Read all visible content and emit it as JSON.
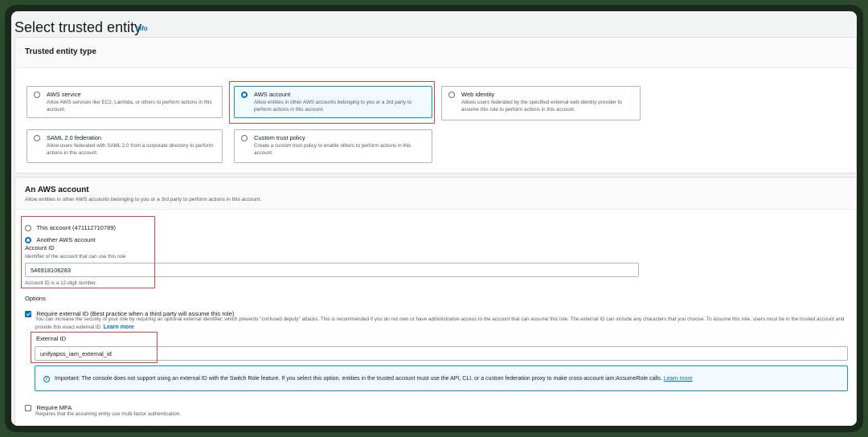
{
  "header": {
    "title": "Select trusted entity",
    "info": "Info"
  },
  "trusted_entity": {
    "title": "Trusted entity type",
    "options": [
      {
        "label": "AWS service",
        "desc": "Allow AWS services like EC2, Lambda, or others to perform actions in this account.",
        "selected": false
      },
      {
        "label": "AWS account",
        "desc": "Allow entities in other AWS accounts belonging to you or a 3rd party to perform actions in this account.",
        "selected": true
      },
      {
        "label": "Web identity",
        "desc": "Allows users federated by the specified external web identity provider to assume this role to perform actions in this account.",
        "selected": false
      },
      {
        "label": "SAML 2.0 federation",
        "desc": "Allow users federated with SAML 2.0 from a corporate directory to perform actions in this account.",
        "selected": false
      },
      {
        "label": "Custom trust policy",
        "desc": "Create a custom trust policy to enable others to perform actions in this account.",
        "selected": false
      }
    ]
  },
  "aws_account": {
    "title": "An AWS account",
    "desc": "Allow entities in other AWS accounts belonging to you or a 3rd party to perform actions in this account.",
    "this_account": "This account (471112710789)",
    "another_account": "Another AWS account",
    "account_id_label": "Account ID",
    "account_id_desc": "Identifier of the account that can use this role",
    "account_id_value": "546918106283",
    "account_id_hint": "Account ID is a 12-digit number.",
    "options_label": "Options",
    "require_external_label": "Require external ID (Best practice when a third party will assume this role)",
    "require_external_desc": "You can increase the security of your role by requiring an optional external identifier, which prevents \"confused deputy\" attacks. This is recommended if you do not own or have administrative access to the account that can assume this role. The external ID can include any characters that you choose. To assume this role, users must be in the trusted account and provide this exact external ID.",
    "learn_more": "Learn more",
    "external_id_label": "External ID",
    "external_id_value": "unifyapss_iam_external_id",
    "alert_text": "Important: The console does not support using an external ID with the Switch Role feature. If you select this option, entities in the trusted account must use the API, CLI, or a custom federation proxy to make cross-account iam:AssumeRole calls.",
    "alert_link": "Learn more",
    "require_mfa_label": "Require MFA",
    "require_mfa_desc": "Requires that the assuming entity use multi-factor authentication."
  },
  "colors": {
    "accent": "#0073bb",
    "highlight": "#e0473a",
    "alert_bg": "#f1faff"
  }
}
